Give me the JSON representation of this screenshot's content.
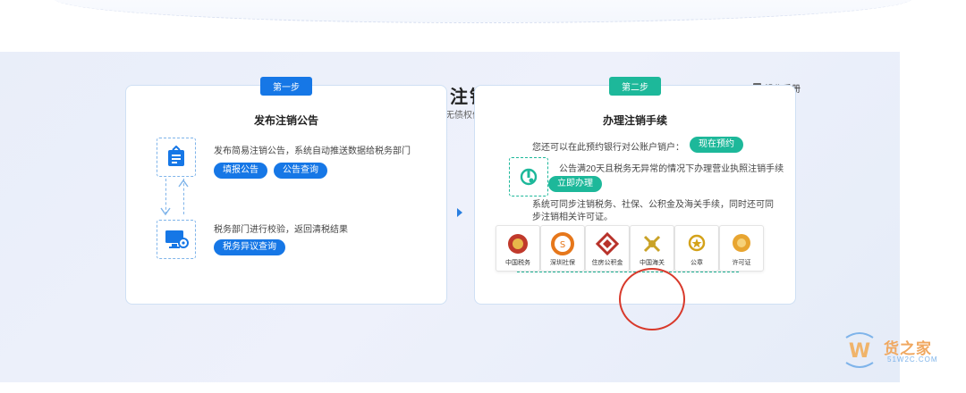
{
  "header": {
    "title": "简易注销",
    "subtitle": "适用于未开业或无债权债务的企业",
    "manual_label": "操作手册"
  },
  "step1": {
    "tag": "第一步",
    "title": "发布注销公告",
    "item1_desc": "发布简易注销公告，系统自动推送数据给税务部门",
    "btn_fill": "填报公告",
    "btn_query": "公告查询",
    "item2_desc": "税务部门进行校验，返回清税结果",
    "btn_objection": "税务异议查询"
  },
  "step2": {
    "tag": "第二步",
    "title": "办理注销手续",
    "reserve_text": "您还可以在此预约银行对公账户销户：",
    "btn_reserve": "现在预约",
    "notice_text": "公告满20天且税务无异常的情况下办理营业执照注销手续",
    "btn_now": "立即办理",
    "sync_text_1": "系统可同步注销税务、社保、公积金及海关手续，同时还可同",
    "sync_text_2": "步注销相关许可证。",
    "logos": [
      {
        "label": "中国税务",
        "icon": "tax-emblem-icon",
        "color": "#c0392b"
      },
      {
        "label": "深圳社保",
        "icon": "social-security-icon",
        "color": "#e6771b"
      },
      {
        "label": "住房公积金",
        "icon": "housing-fund-icon",
        "color": "#b8322a"
      },
      {
        "label": "中国海关",
        "icon": "customs-emblem-icon",
        "color": "#c9a227"
      },
      {
        "label": "公章",
        "icon": "seal-icon",
        "color": "#d4a21a"
      },
      {
        "label": "许可证",
        "icon": "license-icon",
        "color": "#e8a530"
      }
    ]
  },
  "watermark": {
    "brand": "货之家",
    "sub": "51W2C.COM"
  },
  "colors": {
    "primary_blue": "#1677e6",
    "primary_green": "#1db89a",
    "highlight_red": "#d8392b"
  }
}
